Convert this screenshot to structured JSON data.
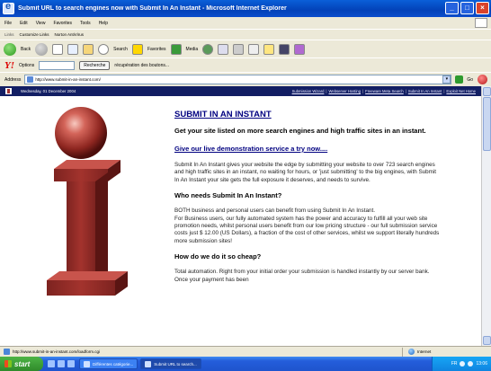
{
  "window": {
    "title": "Submit URL to search engines now with Submit In An Instant - Microsoft Internet Explorer",
    "minimize": "_",
    "maximize": "□",
    "close": "×"
  },
  "menu": [
    "File",
    "Edit",
    "View",
    "Favorites",
    "Tools",
    "Help"
  ],
  "links_bar": {
    "label": "Links",
    "items": [
      "Customize Links",
      "Norton AntiVirus"
    ]
  },
  "toolbar": {
    "back": "Back",
    "search": "Search",
    "favorites": "Favorites",
    "media": "Media"
  },
  "yahoo_bar": {
    "logo": "Y!",
    "options": "Options",
    "search_button": "Recherche",
    "status": "récupération des boutons..."
  },
  "address_bar": {
    "label": "Address",
    "url": "http://www.submit-in-an-instant.com/",
    "go": "Go"
  },
  "site": {
    "date": "Wednesday, 01 December 2004",
    "nav": [
      "Submission Wizard",
      "Webserver Hosting",
      "Freeware Meta Search",
      "Submit In An Instant",
      "Exploit Net Home"
    ],
    "heading": "SUBMIT IN AN INSTANT",
    "lead": "Get your site listed on more search engines and high traffic sites in an instant.",
    "demo_link": "Give our live demonstration service a try now....",
    "intro": "Submit In An Instant gives your website the edge by submitting your website to over 723 search engines and high traffic sites in an instant, no waiting for hours, or 'just submitting' to the big engines, with Submit In An Instant your site gets the full exposure it deserves, and needs to survive.",
    "who_heading": "Who needs Submit In An Instant?",
    "who_p1": "BOTH business and personal users can benefit from using Submit In An Instant.",
    "who_p2": "For Business users, our fully automated system has the power and accuracy to fulfill all your web site promotion needs, whilst personal users benefit from our low pricing structure - our full submission service costs just $ 12.00 (US Dollars), a fraction of the cost of other services, whilst we support literally hundreds more submission sites!",
    "how_heading": "How do we do it so cheap?",
    "how_p": "Total automation. Right from your initial order your submission is handled instantly by our server bank. Once your payment has been"
  },
  "statusbar": {
    "text": "http://www.submit-in-an-instant.com/loadform.cgi",
    "zone": "Internet"
  },
  "taskbar": {
    "start": "start",
    "tasks": [
      "Différentes catégorie...",
      "Submit URL to search..."
    ],
    "clock": "13:06",
    "lang": "FR"
  },
  "colors": {
    "site_header": "#121e63",
    "heading_blue": "#000080",
    "logo_red": "#a03030"
  }
}
